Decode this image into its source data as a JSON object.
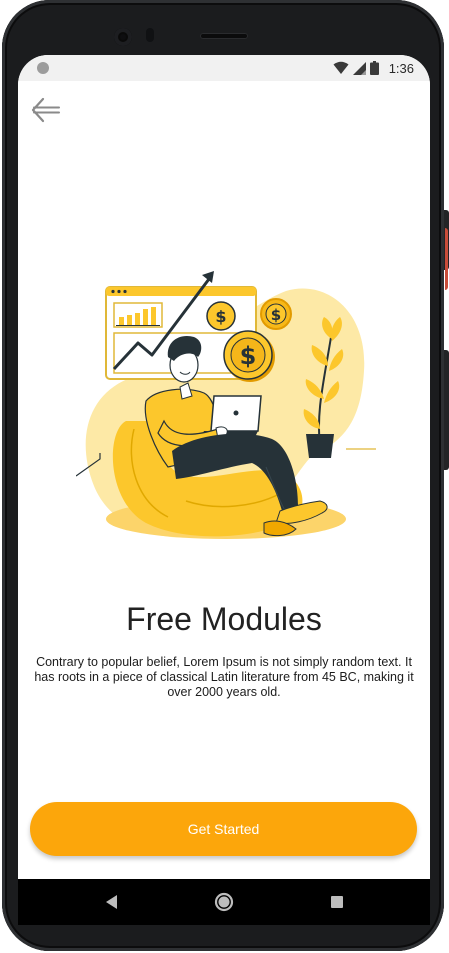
{
  "status_bar": {
    "time": "1:36",
    "icons": [
      "notification-dot-icon",
      "wifi-icon",
      "cell-signal-icon",
      "battery-icon"
    ]
  },
  "header": {
    "back_icon": "back-arrow-icon"
  },
  "illustration": {
    "subject": "onboarding-illustration",
    "colors": {
      "primary": "#fcc72c",
      "light": "#fde9a6",
      "dark": "#263238"
    }
  },
  "content": {
    "title": "Free Modules",
    "description": "Contrary to popular belief, Lorem Ipsum is not simply random text. It has roots in a piece of classical Latin literature from 45 BC, making it over 2000 years old."
  },
  "actions": {
    "get_started_label": "Get Started"
  },
  "nav_bar": {
    "icons": [
      "nav-back-icon",
      "nav-home-icon",
      "nav-recents-icon"
    ]
  },
  "colors": {
    "accent": "#fca60b",
    "text": "#222222",
    "device": "#1b1c1e"
  }
}
